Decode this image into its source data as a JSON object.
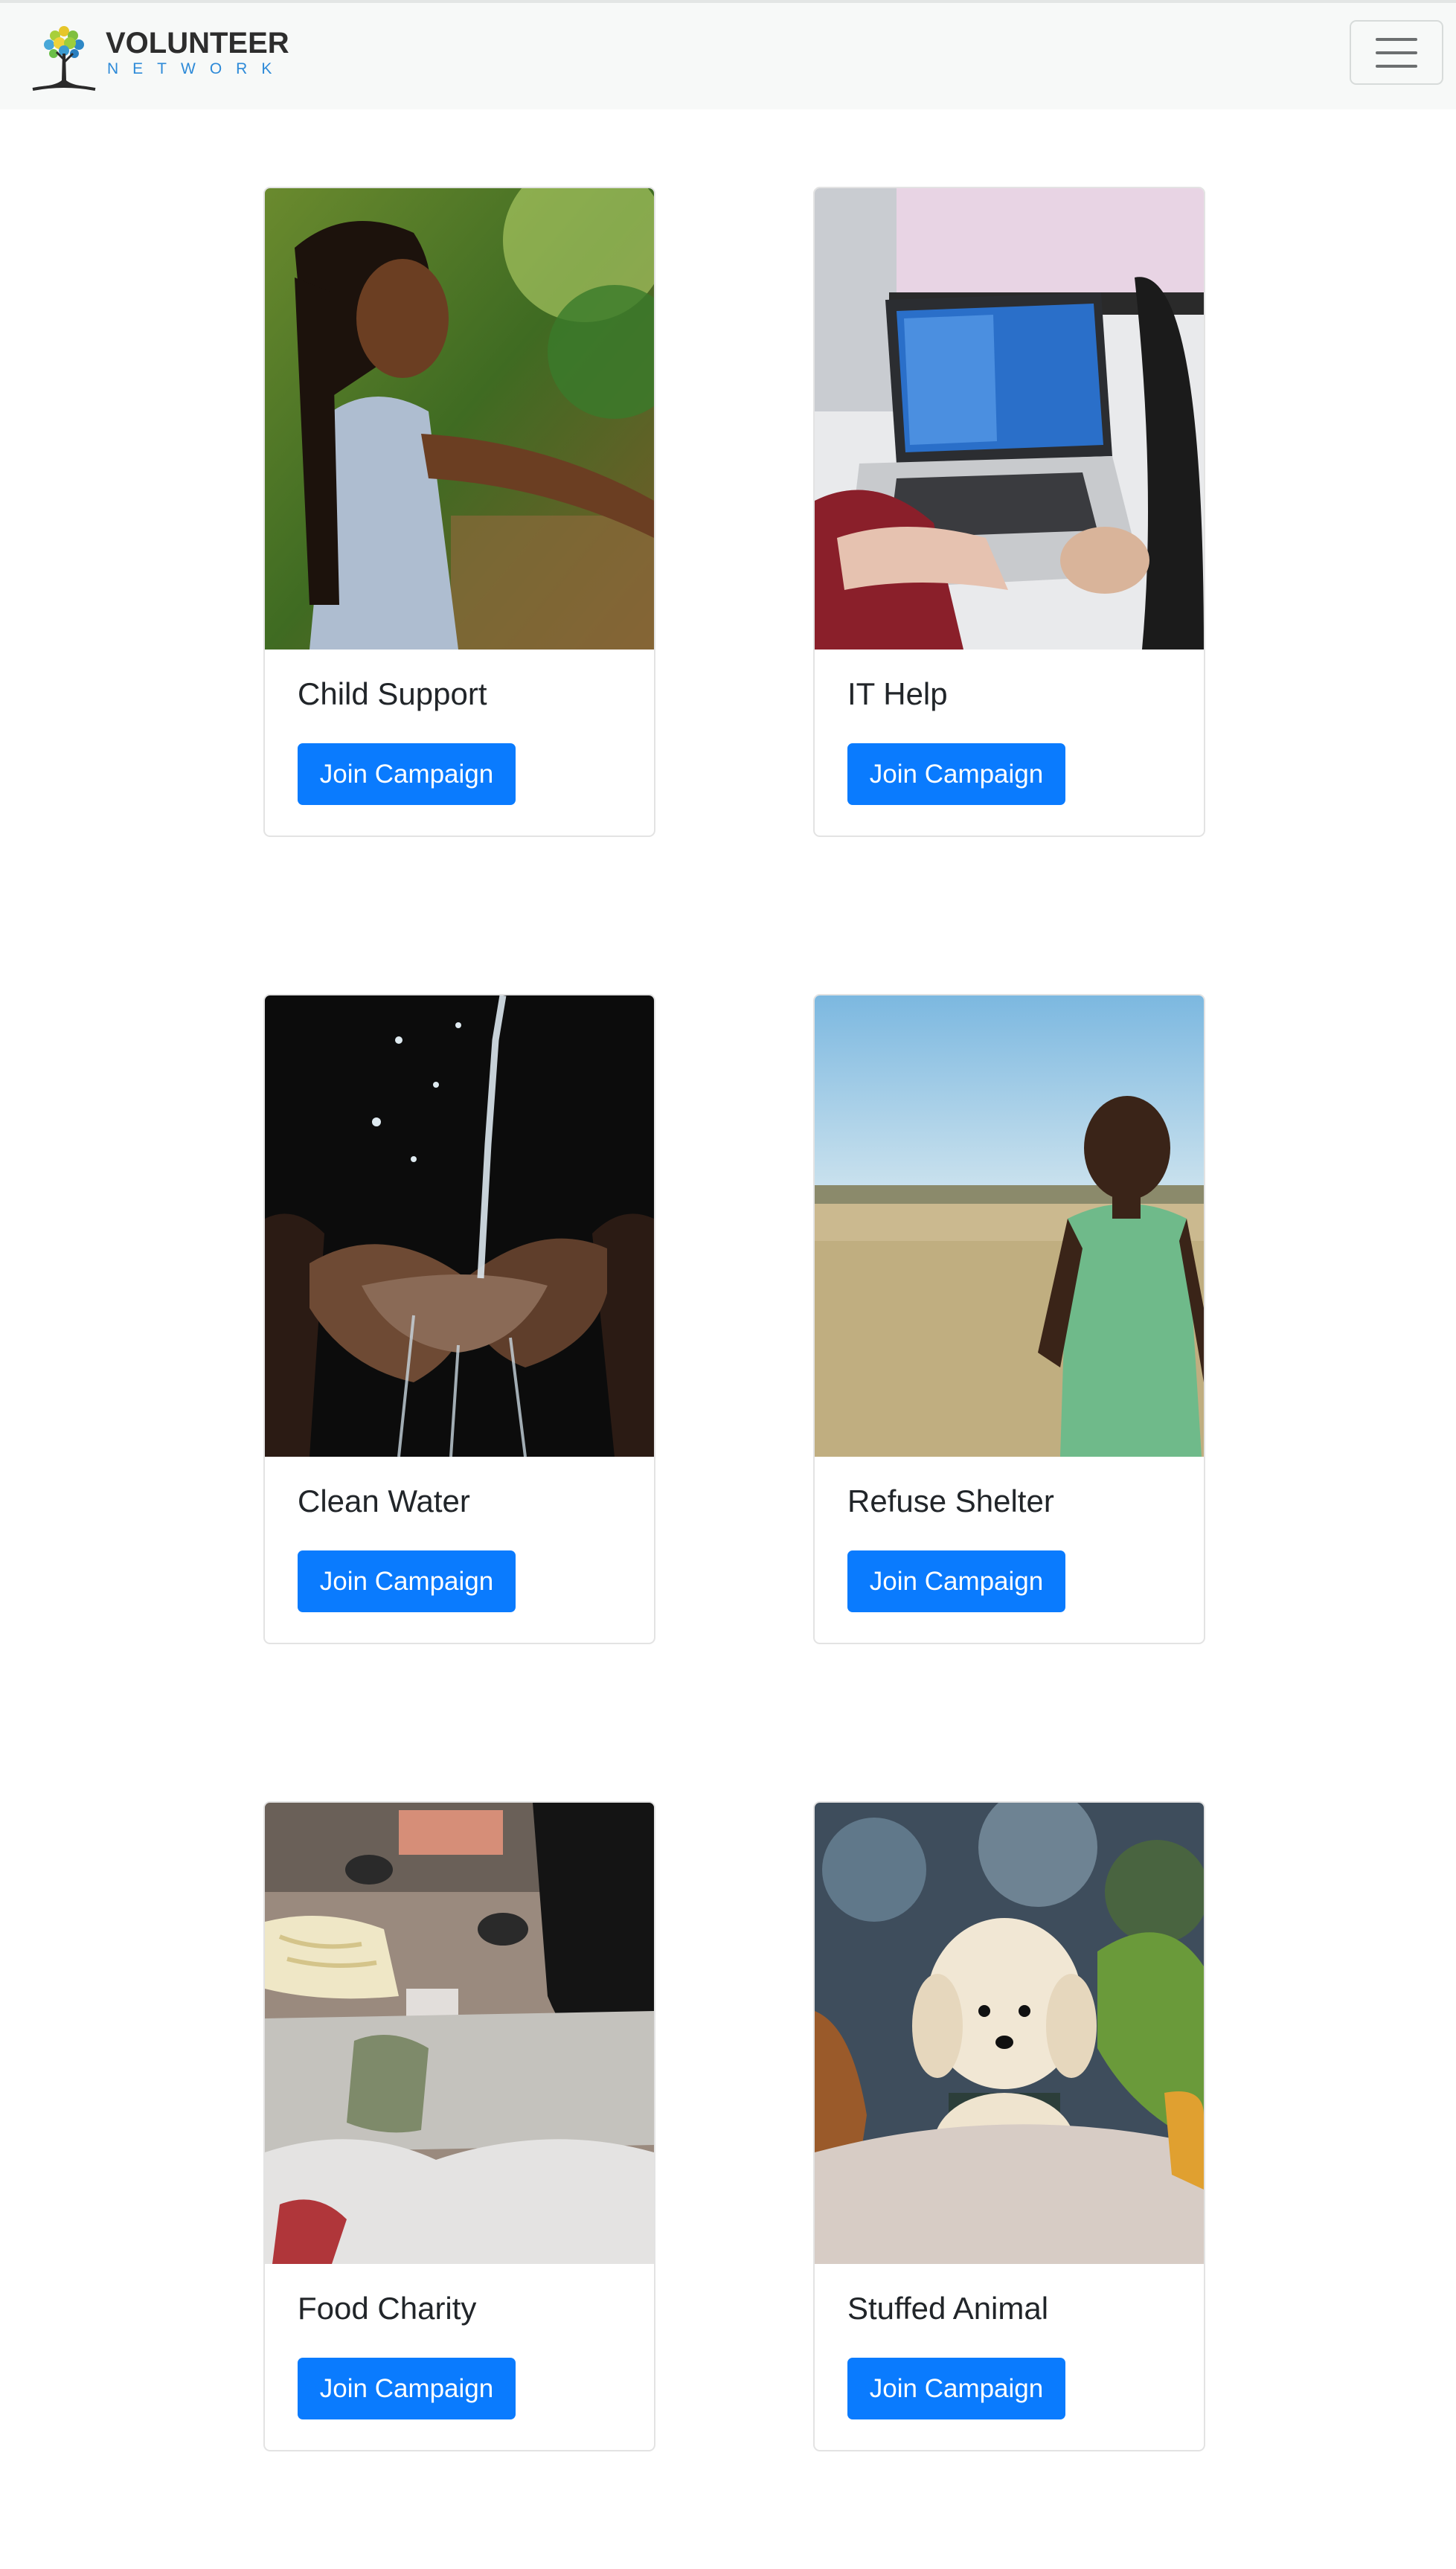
{
  "header": {
    "brand_title": "VOLUNTEER",
    "brand_subtitle": "NETWORK",
    "logo_icon": "tree-icon",
    "menu_icon": "hamburger-menu-icon"
  },
  "colors": {
    "accent": "#0a7bfe",
    "brand_blue": "#2d8ad8",
    "navbar_bg": "#f7f9f8"
  },
  "campaigns": [
    {
      "title": "Child Support",
      "button_label": "Join Campaign"
    },
    {
      "title": "IT Help",
      "button_label": "Join Campaign"
    },
    {
      "title": "Clean Water",
      "button_label": "Join Campaign"
    },
    {
      "title": "Refuse Shelter",
      "button_label": "Join Campaign"
    },
    {
      "title": "Food Charity",
      "button_label": "Join Campaign"
    },
    {
      "title": "Stuffed Animal",
      "button_label": "Join Campaign"
    }
  ]
}
